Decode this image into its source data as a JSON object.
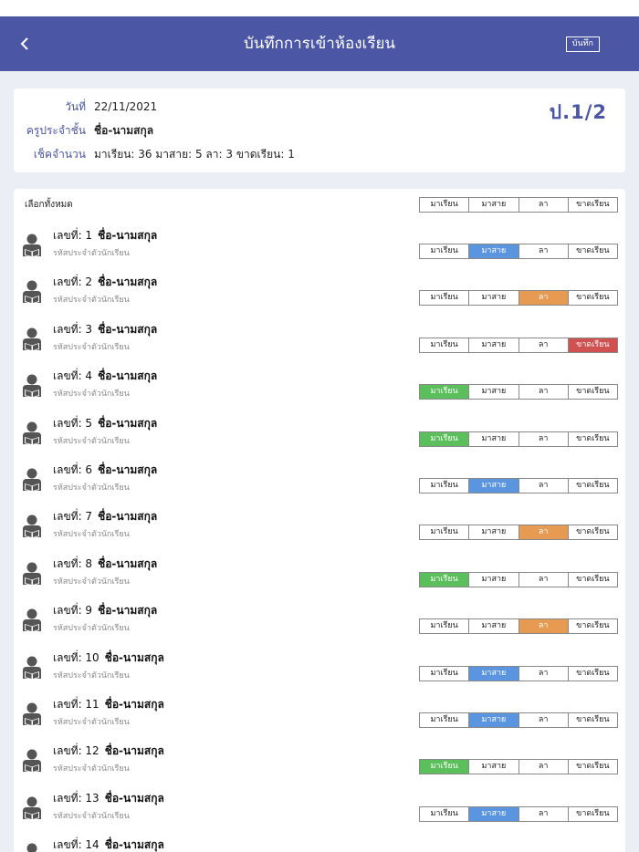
{
  "nav": {
    "title": "บันทึกการเข้าห้องเรียน",
    "save": "บันทึก",
    "back_icon": "chevron-left-icon"
  },
  "info": {
    "date_label": "วันที่",
    "date": "22/11/2021",
    "teacher_label": "ครูประจำชั้น",
    "teacher": "ชื่อ-นามสกุล",
    "count_label": "เช็คจำนวน",
    "count": "มาเรียน: 36 มาสาย: 5 ลา: 3 ขาดเรียน: 1",
    "class_name": "ป.1/2"
  },
  "list": {
    "select_all": "เลือกทั้งหมด",
    "status_labels": [
      "มาเรียน",
      "มาสาย",
      "ลา",
      "ขาดเรียน"
    ],
    "id_label": "รหัสประจำตัวนักเรียน",
    "avatar_icon": "student-reading-icon",
    "status_colors": {
      "present": "#5bbf5b",
      "late": "#5b95e0",
      "leave": "#e79a52",
      "absent": "#cf5150"
    },
    "students": [
      {
        "no": "เลขที่: 1",
        "name": "ชื่อ-นามสกุล",
        "status": 1
      },
      {
        "no": "เลขที่: 2",
        "name": "ชื่อ-นามสกุล",
        "status": 2
      },
      {
        "no": "เลขที่: 3",
        "name": "ชื่อ-นามสกุล",
        "status": 3
      },
      {
        "no": "เลขที่: 4",
        "name": "ชื่อ-นามสกุล",
        "status": 0
      },
      {
        "no": "เลขที่: 5",
        "name": "ชื่อ-นามสกุล",
        "status": 0
      },
      {
        "no": "เลขที่: 6",
        "name": "ชื่อ-นามสกุล",
        "status": 1
      },
      {
        "no": "เลขที่: 7",
        "name": "ชื่อ-นามสกุล",
        "status": 2
      },
      {
        "no": "เลขที่: 8",
        "name": "ชื่อ-นามสกุล",
        "status": 0
      },
      {
        "no": "เลขที่: 9",
        "name": "ชื่อ-นามสกุล",
        "status": 2
      },
      {
        "no": "เลขที่: 10",
        "name": "ชื่อ-นามสกุล",
        "status": 1
      },
      {
        "no": "เลขที่: 11",
        "name": "ชื่อ-นามสกุล",
        "status": 1
      },
      {
        "no": "เลขที่: 12",
        "name": "ชื่อ-นามสกุล",
        "status": 0
      },
      {
        "no": "เลขที่: 13",
        "name": "ชื่อ-นามสกุล",
        "status": 1
      },
      {
        "no": "เลขที่: 14",
        "name": "ชื่อ-นามสกุล",
        "status": -1
      }
    ]
  }
}
